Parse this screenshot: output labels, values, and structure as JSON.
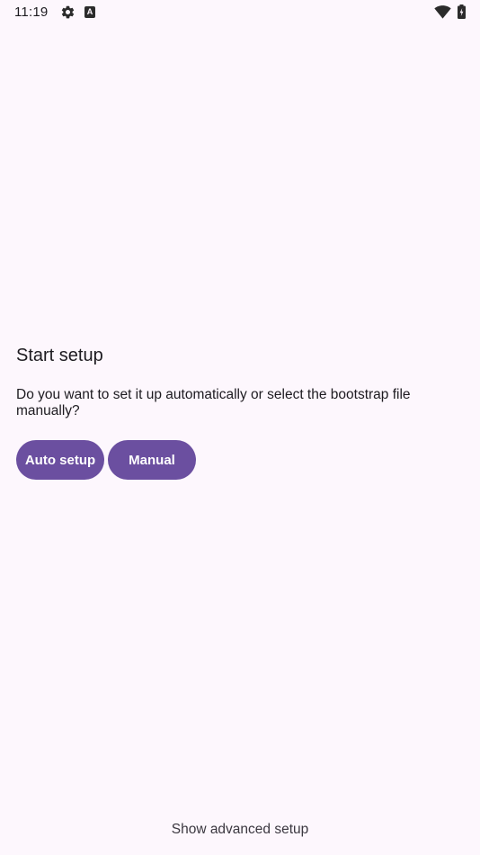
{
  "status_bar": {
    "time": "11:19",
    "icons": [
      "gear-icon",
      "a-badge-icon",
      "wifi-icon",
      "battery-icon"
    ],
    "a_badge": "A"
  },
  "setup": {
    "title": "Start setup",
    "description": "Do you want to set it up automatically or select the bootstrap file manually?",
    "auto_button": "Auto setup",
    "manual_button": "Manual",
    "advanced_link": "Show advanced setup"
  },
  "colors": {
    "background": "#FDF7FD",
    "accent": "#6B4FA0",
    "text": "#1D1B20"
  }
}
